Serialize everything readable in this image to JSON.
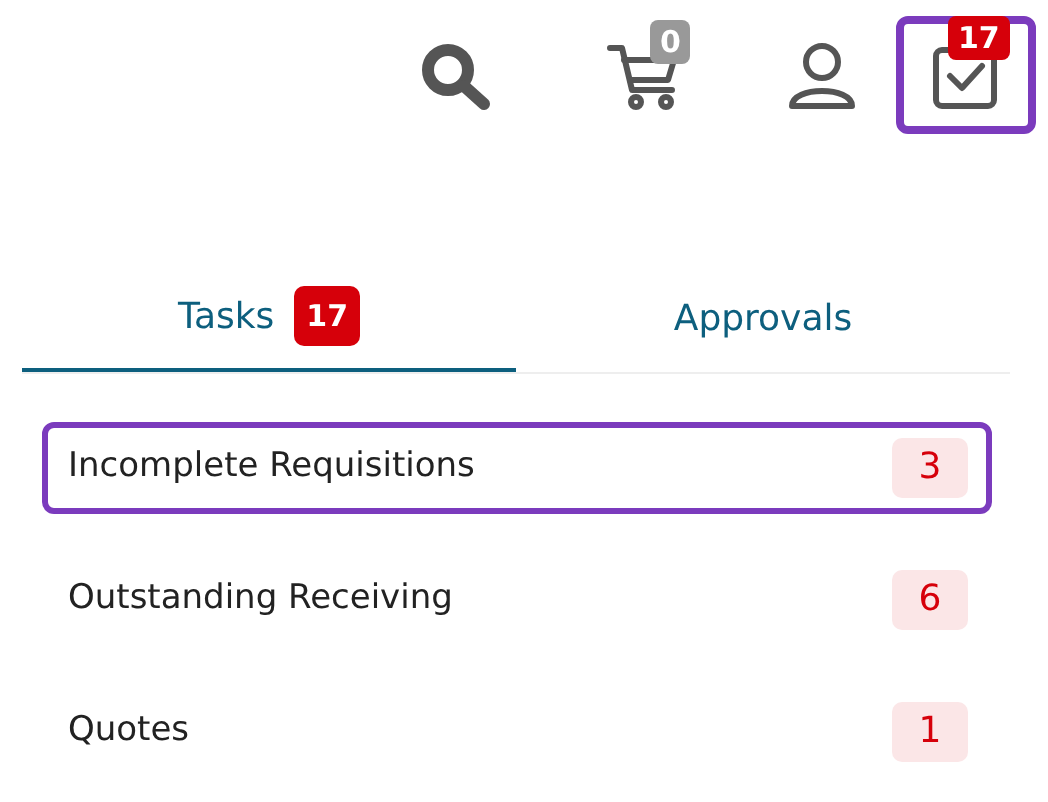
{
  "header_icons": [
    {
      "kind": "search",
      "focused": false
    },
    {
      "kind": "cart",
      "badge": "0",
      "focused": false
    },
    {
      "kind": "user",
      "focused": false
    },
    {
      "kind": "tasks",
      "badge": "17",
      "focused": true
    }
  ],
  "tabs": [
    {
      "label": "Tasks",
      "badge": "17",
      "selected": true
    },
    {
      "label": "Approvals",
      "selected": false
    }
  ],
  "task_list": [
    {
      "label": "Incomplete Requisitions",
      "count": "3",
      "focused": true
    },
    {
      "label": "Outstanding Receiving",
      "count": "6",
      "focused": false
    },
    {
      "label": "Quotes",
      "count": "1",
      "focused": false
    }
  ]
}
